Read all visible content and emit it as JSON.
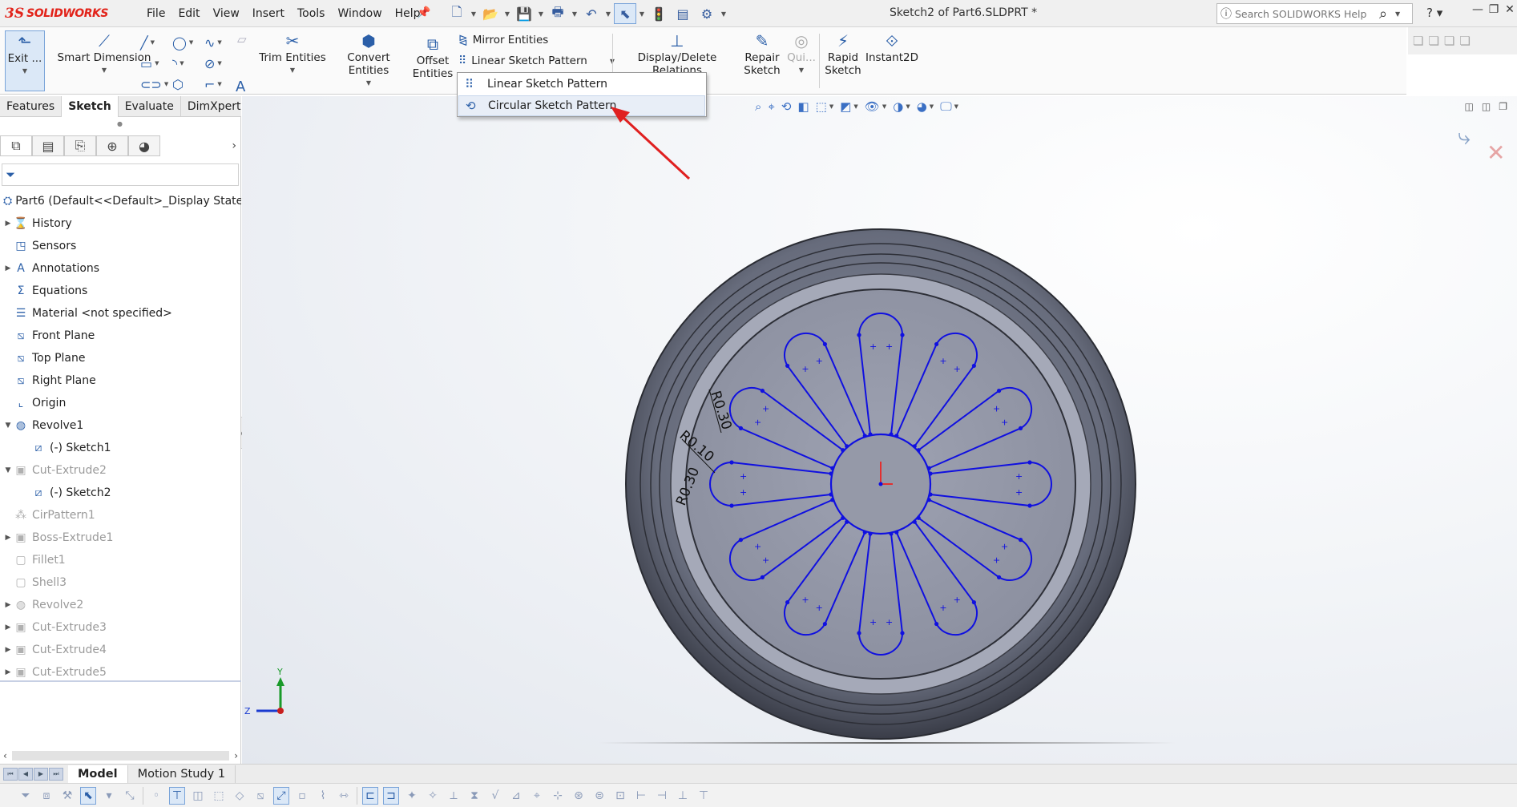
{
  "app": {
    "logo_ds": "3S",
    "logo_text": "SOLIDWORKS",
    "document_title": "Sketch2 of Part6.SLDPRT *",
    "accent_color": "#2b5fa8",
    "sketch_color": "#1010e0"
  },
  "menu": [
    "File",
    "Edit",
    "View",
    "Insert",
    "Tools",
    "Window",
    "Help"
  ],
  "search": {
    "placeholder": "Search SOLIDWORKS Help"
  },
  "command_manager": {
    "exit_sketch": "Exit ...",
    "smart_dimension": "Smart Dimension",
    "trim_entities": "Trim Entities",
    "convert_entities": "Convert Entities",
    "offset_line1": "Offset",
    "offset_line2": "Entities",
    "mirror_entities": "Mirror Entities",
    "linear_sketch_pattern": "Linear Sketch Pattern",
    "display_delete_relations": "Display/Delete Relations",
    "repair_line1": "Repair",
    "repair_line2": "Sketch",
    "quick_snaps": "Qui...",
    "rapid_line1": "Rapid",
    "rapid_line2": "Sketch",
    "instant2d": "Instant2D"
  },
  "pattern_dropdown": {
    "items": [
      "Linear Sketch Pattern",
      "Circular Sketch Pattern"
    ],
    "highlighted": "Circular Sketch Pattern"
  },
  "cm_tabs": [
    "Features",
    "Sketch",
    "Evaluate",
    "DimXpert"
  ],
  "active_cm_tab": "Sketch",
  "tree": {
    "root": "Part6  (Default<<Default>_Display State",
    "items": [
      {
        "label": "History"
      },
      {
        "label": "Sensors"
      },
      {
        "label": "Annotations"
      },
      {
        "label": "Equations"
      },
      {
        "label": "Material <not specified>"
      },
      {
        "label": "Front Plane"
      },
      {
        "label": "Top Plane"
      },
      {
        "label": "Right Plane"
      },
      {
        "label": "Origin"
      },
      {
        "label": "Revolve1"
      },
      {
        "label": "(-) Sketch1"
      },
      {
        "label": "Cut-Extrude2"
      },
      {
        "label": "(-) Sketch2"
      },
      {
        "label": "CirPattern1"
      },
      {
        "label": "Boss-Extrude1"
      },
      {
        "label": "Fillet1"
      },
      {
        "label": "Shell3"
      },
      {
        "label": "Revolve2"
      },
      {
        "label": "Cut-Extrude3"
      },
      {
        "label": "Cut-Extrude4"
      },
      {
        "label": "Cut-Extrude5"
      }
    ]
  },
  "dimensions": [
    "R0.30",
    "R0.10",
    "R0.30"
  ],
  "triad": {
    "y": "Y",
    "z": "Z"
  },
  "bottom_tabs": [
    "Model",
    "Motion Study 1"
  ],
  "active_bottom_tab": "Model"
}
